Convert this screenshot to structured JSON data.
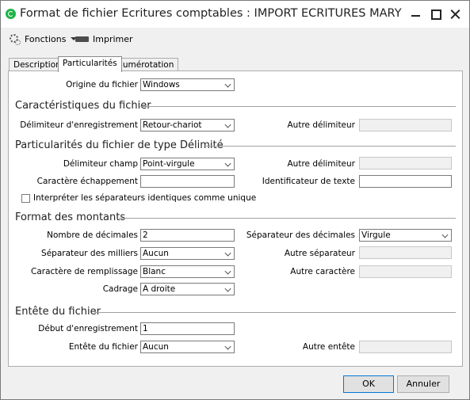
{
  "window": {
    "title": "Format de fichier Ecritures comptables : IMPORT ECRITURES MARY"
  },
  "toolbar": {
    "fonctions_label": "Fonctions",
    "imprimer_label": "Imprimer"
  },
  "tabs": [
    {
      "label": "Description"
    },
    {
      "label": "Particularités"
    },
    {
      "label": "Numérotation"
    }
  ],
  "origine": {
    "label": "Origine du fichier",
    "value": "Windows"
  },
  "sections": {
    "caracteristiques": "Caractéristiques du fichier",
    "delimite": "Particularités du fichier de type Délimité",
    "montants": "Format des montants",
    "entete": "Entête du fichier"
  },
  "caracteristiques": {
    "delimiteur_enr_label": "Délimiteur d'enregistrement",
    "delimiteur_enr_value": "Retour-chariot",
    "autre_delimiteur_label": "Autre délimiteur"
  },
  "delimite": {
    "delimiteur_champ_label": "Délimiteur champ",
    "delimiteur_champ_value": "Point-virgule",
    "autre_delimiteur_label": "Autre délimiteur",
    "caractere_echappement_label": "Caractère échappement",
    "caractere_echappement_value": "",
    "identificateur_texte_label": "Identificateur de texte",
    "identificateur_texte_value": "",
    "interpreter_label": "Interpréter les séparateurs identiques comme unique"
  },
  "montants": {
    "nb_decimales_label": "Nombre de décimales",
    "nb_decimales_value": "2",
    "sep_decimales_label": "Séparateur des décimales",
    "sep_decimales_value": "Virgule",
    "sep_milliers_label": "Séparateur des milliers",
    "sep_milliers_value": "Aucun",
    "autre_separateur_label": "Autre séparateur",
    "car_remplissage_label": "Caractère de remplissage",
    "car_remplissage_value": "Blanc",
    "autre_caractere_label": "Autre caractère",
    "cadrage_label": "Cadrage",
    "cadrage_value": "A droite"
  },
  "entete": {
    "debut_label": "Début d'enregistrement",
    "debut_value": "1",
    "entete_label": "Entête du fichier",
    "entete_value": "Aucun",
    "autre_entete_label": "Autre entête"
  },
  "buttons": {
    "ok": "OK",
    "annuler": "Annuler"
  },
  "colors": {
    "app_icon": "#1fb34a",
    "window_bg": "#f0f0f0",
    "panel_bg": "#ffffff"
  }
}
